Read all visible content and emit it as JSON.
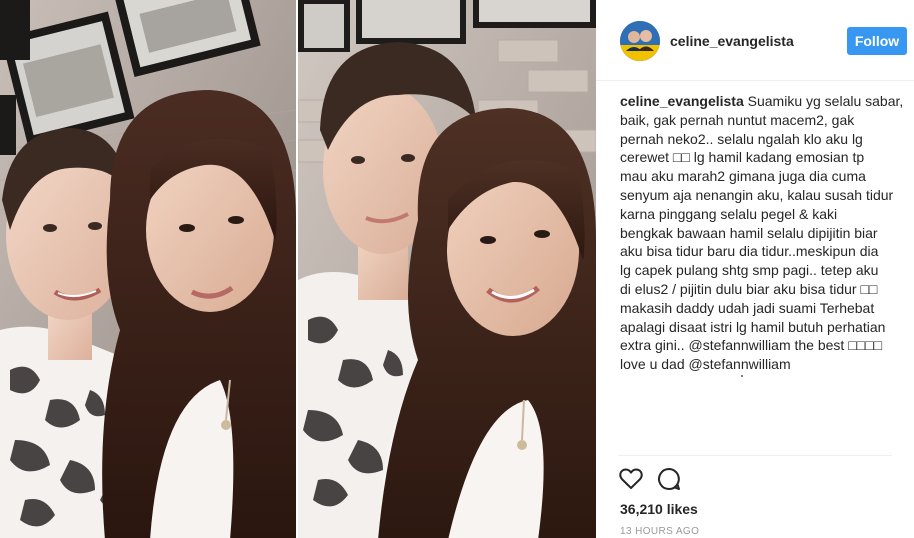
{
  "post": {
    "username": "celine_evangelista",
    "follow_label": "Follow",
    "caption_user": "celine_evangelista",
    "caption_lines": [
      " Suamiku yg selalu sabar,",
      "baik, gak pernah nuntut macem2, gak",
      "pernah neko2.. selalu ngalah klo aku lg",
      "cerewet □□ lg hamil kadang emosian tp",
      "mau aku marah2 gimana juga dia cuma",
      "senyum aja nenangin aku, kalau susah tidur",
      "karna pinggang selalu pegel & kaki",
      "bengkak bawaan hamil selalu dipijitin biar",
      "aku bisa tidur baru dia tidur..meskipun dia",
      "lg capek pulang shtg smp pagi.. tetep aku",
      "di elus2 / pijitin dulu biar aku bisa tidur □□",
      "makasih daddy udah jadi suami Terhebat",
      "apalagi disaat istri lg hamil butuh perhatian",
      "extra gini.. @stefannwilliam the best □□□□",
      "love u dad @stefannwilliam"
    ],
    "likes": "36,210 likes",
    "timestamp": "13 HOURS AGO"
  },
  "icons": {
    "like": "heart-icon",
    "comment": "comment-bubble-icon"
  },
  "colors": {
    "follow_button": "#3897f0",
    "text": "#262626",
    "muted": "#999999",
    "divider": "#efefef"
  }
}
